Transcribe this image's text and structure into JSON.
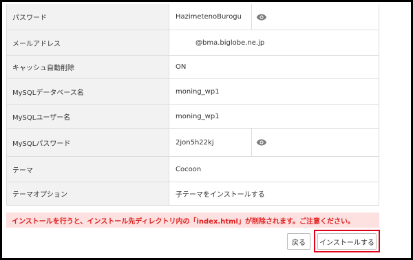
{
  "fields": [
    {
      "label": "パスワード",
      "value": "HazimetenoBurogu",
      "icon": "eye-icon"
    },
    {
      "label": "メールアドレス",
      "value": "@bma.biglobe.ne.jp"
    },
    {
      "label": "キャッシュ自動削除",
      "value": "ON"
    },
    {
      "label": "MySQLデータベース名",
      "value": "moning_wp1"
    },
    {
      "label": "MySQLユーザー名",
      "value": "moning_wp1"
    },
    {
      "label": "MySQLパスワード",
      "value": "2jon5h22kj",
      "icon": "eye-icon"
    },
    {
      "label": "テーマ",
      "value": "Cocoon"
    },
    {
      "label": "テーマオプション",
      "value": "子テーマをインストールする"
    }
  ],
  "notice": "インストールを行うと、インストール先ディレクトリ内の「index.html」が削除されます。ご注意ください。",
  "buttons": {
    "back": "戻る",
    "install": "インストールする"
  },
  "colors": {
    "label_bg": "#f2f2f2",
    "notice_bg": "#fde0e0",
    "notice_text": "#e02020",
    "highlight": "#e3001b"
  }
}
